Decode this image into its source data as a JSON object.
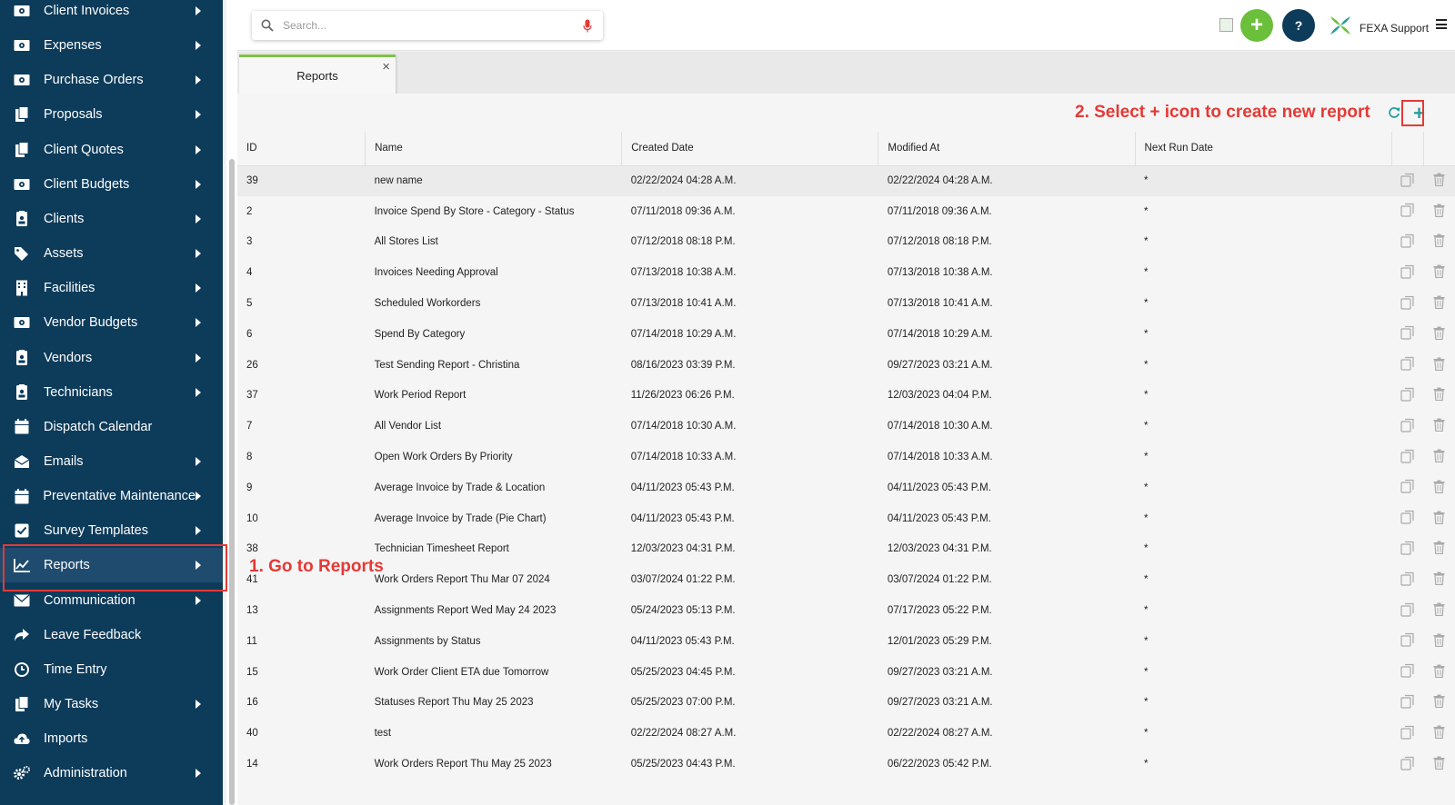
{
  "sidebar": {
    "items": [
      {
        "label": "Client Invoices",
        "icon": "money-icon",
        "arrow": true
      },
      {
        "label": "Expenses",
        "icon": "money-icon",
        "arrow": true
      },
      {
        "label": "Purchase Orders",
        "icon": "money-icon",
        "arrow": true
      },
      {
        "label": "Proposals",
        "icon": "document-copy-icon",
        "arrow": true
      },
      {
        "label": "Client Quotes",
        "icon": "document-copy-icon",
        "arrow": true
      },
      {
        "label": "Client Budgets",
        "icon": "money-icon",
        "arrow": true
      },
      {
        "label": "Clients",
        "icon": "id-badge-icon",
        "arrow": true
      },
      {
        "label": "Assets",
        "icon": "tags-icon",
        "arrow": true
      },
      {
        "label": "Facilities",
        "icon": "building-icon",
        "arrow": true
      },
      {
        "label": "Vendor Budgets",
        "icon": "money-icon",
        "arrow": true
      },
      {
        "label": "Vendors",
        "icon": "id-badge-icon",
        "arrow": true
      },
      {
        "label": "Technicians",
        "icon": "id-badge-icon",
        "arrow": true
      },
      {
        "label": "Dispatch Calendar",
        "icon": "calendar-icon",
        "arrow": false
      },
      {
        "label": "Emails",
        "icon": "envelope-open-icon",
        "arrow": true
      },
      {
        "label": "Preventative Maintenance",
        "icon": "calendar-icon",
        "arrow": true
      },
      {
        "label": "Survey Templates",
        "icon": "check-square-icon",
        "arrow": true
      },
      {
        "label": "Reports",
        "icon": "line-chart-icon",
        "arrow": true
      },
      {
        "label": "Communication",
        "icon": "envelope-icon",
        "arrow": true
      },
      {
        "label": "Leave Feedback",
        "icon": "share-icon",
        "arrow": false
      },
      {
        "label": "Time Entry",
        "icon": "clock-icon",
        "arrow": false
      },
      {
        "label": "My Tasks",
        "icon": "document-copy-icon",
        "arrow": true
      },
      {
        "label": "Imports",
        "icon": "cloud-upload-icon",
        "arrow": false
      },
      {
        "label": "Administration",
        "icon": "cogs-icon",
        "arrow": true
      }
    ],
    "active_index": 16
  },
  "header": {
    "search_placeholder": "Search...",
    "brand_name": "FEXA Support",
    "add_label": "+",
    "help_label": "?"
  },
  "tabs": [
    {
      "label": "Reports",
      "close": "×"
    }
  ],
  "toolbar": {
    "create_label": "+"
  },
  "table": {
    "columns": [
      "ID",
      "Name",
      "Created Date",
      "Modified At",
      "Next Run Date"
    ],
    "rows": [
      [
        "39",
        "new name",
        "02/22/2024 04:28 A.M.",
        "02/22/2024 04:28 A.M.",
        "*"
      ],
      [
        "2",
        "Invoice Spend By Store - Category - Status",
        "07/11/2018 09:36 A.M.",
        "07/11/2018 09:36 A.M.",
        "*"
      ],
      [
        "3",
        "All Stores List",
        "07/12/2018 08:18 P.M.",
        "07/12/2018 08:18 P.M.",
        "*"
      ],
      [
        "4",
        "Invoices Needing Approval",
        "07/13/2018 10:38 A.M.",
        "07/13/2018 10:38 A.M.",
        "*"
      ],
      [
        "5",
        "Scheduled Workorders",
        "07/13/2018 10:41 A.M.",
        "07/13/2018 10:41 A.M.",
        "*"
      ],
      [
        "6",
        "Spend By Category",
        "07/14/2018 10:29 A.M.",
        "07/14/2018 10:29 A.M.",
        "*"
      ],
      [
        "26",
        "Test Sending Report - Christina",
        "08/16/2023 03:39 P.M.",
        "09/27/2023 03:21 A.M.",
        "*"
      ],
      [
        "37",
        "Work Period Report",
        "11/26/2023 06:26 P.M.",
        "12/03/2023 04:04 P.M.",
        "*"
      ],
      [
        "7",
        "All Vendor List",
        "07/14/2018 10:30 A.M.",
        "07/14/2018 10:30 A.M.",
        "*"
      ],
      [
        "8",
        "Open Work Orders By Priority",
        "07/14/2018 10:33 A.M.",
        "07/14/2018 10:33 A.M.",
        "*"
      ],
      [
        "9",
        "Average Invoice by Trade & Location",
        "04/11/2023 05:43 P.M.",
        "04/11/2023 05:43 P.M.",
        "*"
      ],
      [
        "10",
        "Average Invoice by Trade (Pie Chart)",
        "04/11/2023 05:43 P.M.",
        "04/11/2023 05:43 P.M.",
        "*"
      ],
      [
        "38",
        "Technician Timesheet Report",
        "12/03/2023 04:31 P.M.",
        "12/03/2023 04:31 P.M.",
        "*"
      ],
      [
        "41",
        "Work Orders Report Thu Mar 07 2024",
        "03/07/2024 01:22 P.M.",
        "03/07/2024 01:22 P.M.",
        "*"
      ],
      [
        "13",
        "Assignments Report Wed May 24 2023",
        "05/24/2023 05:13 P.M.",
        "07/17/2023 05:22 P.M.",
        "*"
      ],
      [
        "11",
        "Assignments by Status",
        "04/11/2023 05:43 P.M.",
        "12/01/2023 05:29 P.M.",
        "*"
      ],
      [
        "15",
        "Work Order Client ETA due Tomorrow",
        "05/25/2023 04:45 P.M.",
        "09/27/2023 03:21 A.M.",
        "*"
      ],
      [
        "16",
        "Statuses Report Thu May 25 2023",
        "05/25/2023 07:00 P.M.",
        "09/27/2023 03:21 A.M.",
        "*"
      ],
      [
        "40",
        "test",
        "02/22/2024 08:27 A.M.",
        "02/22/2024 08:27 A.M.",
        "*"
      ],
      [
        "14",
        "Work Orders Report Thu May 25 2023",
        "05/25/2023 04:43 P.M.",
        "06/22/2023 05:42 P.M.",
        "*"
      ]
    ]
  },
  "annotations": {
    "step1": "1. Go to Reports",
    "step2": "2. Select + icon to create new report"
  },
  "colors": {
    "sidebar_bg": "#0d3b5a",
    "accent_green": "#6bbf3a",
    "annotation_red": "#e53935",
    "create_teal": "#2a9d9a"
  }
}
